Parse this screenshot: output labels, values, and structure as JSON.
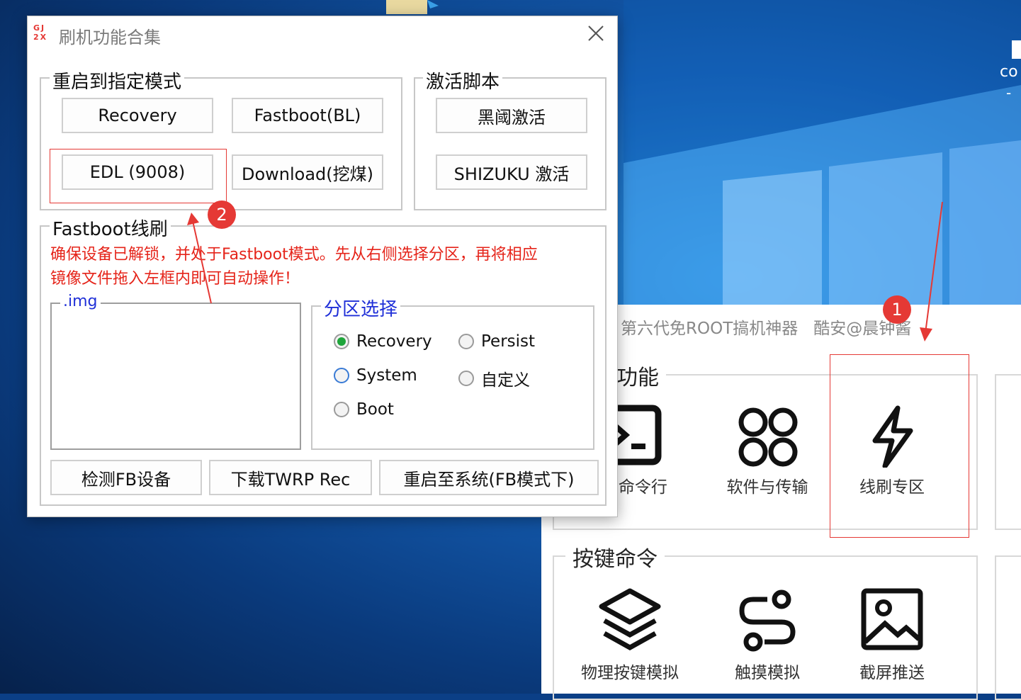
{
  "dialog": {
    "title": "刷机功能合集",
    "app_icon_text": "GJ 2X",
    "reboot_group": {
      "label": "重启到指定模式",
      "buttons": [
        "Recovery",
        "Fastboot(BL)",
        "EDL (9008)",
        "Download(挖煤)"
      ]
    },
    "activate_group": {
      "label": "激活脚本",
      "buttons": [
        "黑阈激活",
        "SHIZUKU 激活"
      ]
    },
    "fastboot_group": {
      "label": "Fastboot线刷",
      "warning_line1": "确保设备已解锁，并处于Fastboot模式。先从右侧选择分区，再将相应",
      "warning_line2": "镜像文件拖入左框内即可自动操作！",
      "img_label": ".img",
      "partition_group": {
        "label": "分区选择",
        "options": [
          "Recovery",
          "Persist",
          "System",
          "自定义",
          "Boot"
        ],
        "selected": "Recovery"
      },
      "buttons": [
        "检测FB设备",
        "下载TWRP Rec",
        "重启至系统(FB模式下)"
      ]
    }
  },
  "background_app": {
    "title": "第六代免ROOT搞机神器",
    "author": "酷安@晨钟酱",
    "group1_label": "功能",
    "group1_tiles": [
      "/FB命令行",
      "软件与传输",
      "线刷专区"
    ],
    "group2_label": "按键命令",
    "group2_tiles": [
      "物理按键模拟",
      "触摸模拟",
      "截屏推送"
    ]
  },
  "desktop": {
    "right_icon_text_1": "co",
    "right_icon_text_2": "- "
  },
  "annotations": {
    "badge1": "1",
    "badge2": "2"
  },
  "colors": {
    "annotation_red": "#e53935",
    "warning_red": "#e5241a",
    "group_label_blue": "#2030d8",
    "radio_selected_green": "#1fa53b"
  }
}
